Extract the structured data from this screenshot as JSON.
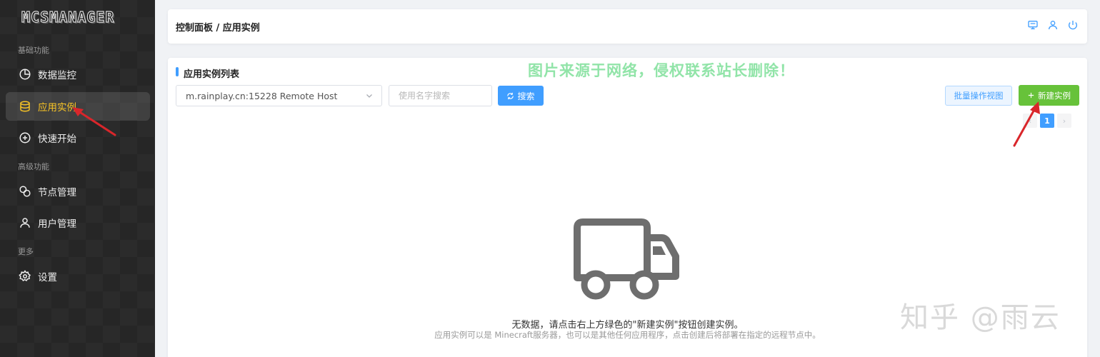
{
  "sidebar": {
    "logo": "MCSMANAGER",
    "groups": {
      "basic": "基础功能",
      "advanced": "高级功能",
      "more": "更多"
    },
    "items": [
      {
        "label": "数据监控",
        "icon": "pie-chart-icon"
      },
      {
        "label": "应用实例",
        "icon": "database-icon",
        "active": true
      },
      {
        "label": "快速开始",
        "icon": "plus-circle-icon"
      },
      {
        "label": "节点管理",
        "icon": "link-icon"
      },
      {
        "label": "用户管理",
        "icon": "user-icon"
      },
      {
        "label": "设置",
        "icon": "gear-icon"
      }
    ]
  },
  "header": {
    "breadcrumb": "控制面板 / 应用实例",
    "icons": [
      "monitor-icon",
      "user-icon",
      "power-icon"
    ]
  },
  "main": {
    "title": "应用实例列表",
    "watermark": "图片来源于网络，侵权联系站长删除！",
    "host_select": {
      "value": "m.rainplay.cn:15228 Remote Host"
    },
    "search": {
      "placeholder": "使用名字搜索",
      "button_label": "搜索"
    },
    "batch_button": "批量操作视图",
    "new_button": "新建实例",
    "pager": {
      "prev": "‹",
      "current": "1",
      "next": "›"
    },
    "empty": {
      "message": "无数据，请点击右上方绿色的\"新建实例\"按钮创建实例。",
      "hint": "应用实例可以是 Minecraft服务器，也可以是其他任何应用程序，点击创建后将部署在指定的远程节点中。"
    }
  },
  "overlay": {
    "zhihu_watermark": "知乎 @雨云"
  },
  "colors": {
    "accent": "#409eff",
    "success": "#67c23a",
    "active_menu": "#f7c325",
    "annotation": "#d9262b"
  }
}
